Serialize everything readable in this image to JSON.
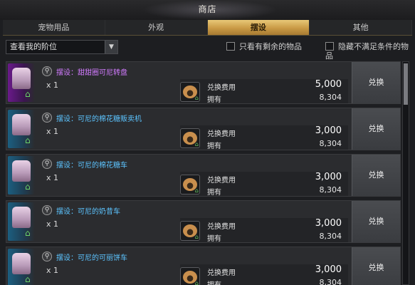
{
  "header": {
    "title": "商店"
  },
  "tabs": [
    {
      "label": "宠物用品",
      "active": false
    },
    {
      "label": "外观",
      "active": false
    },
    {
      "label": "摆设",
      "active": true
    },
    {
      "label": "其他",
      "active": false
    }
  ],
  "filters": {
    "dropdown_value": "查看我的阶位",
    "only_remaining": "只看有剩余的物品",
    "hide_unmet": "隐藏不满足条件的物品"
  },
  "labels": {
    "cost": "兑换费用",
    "owned": "拥有",
    "redeem_button": "兑换"
  },
  "items": [
    {
      "name": "摆设：甜甜圈可尼转盘",
      "quantity": "x 1",
      "cost": "5,000",
      "owned": "8,304",
      "rarity": "purple"
    },
    {
      "name": "摆设：可尼的棉花糖贩卖机",
      "quantity": "x 1",
      "cost": "3,000",
      "owned": "8,304",
      "rarity": "blue"
    },
    {
      "name": "摆设：可尼的棉花糖车",
      "quantity": "x 1",
      "cost": "3,000",
      "owned": "8,304",
      "rarity": "blue"
    },
    {
      "name": "摆设：可尼的奶昔车",
      "quantity": "x 1",
      "cost": "3,000",
      "owned": "8,304",
      "rarity": "blue"
    },
    {
      "name": "摆设：可尼的可丽饼车",
      "quantity": "x 1",
      "cost": "3,000",
      "owned": "8,304",
      "rarity": "blue"
    }
  ],
  "colors": {
    "active_tab": "#c99a45",
    "purple_name": "#d27bff",
    "blue_name": "#5cc4ff"
  },
  "icons": {
    "search": "magnifier-icon",
    "currency": "paw-token-icon",
    "house": "house-icon",
    "dropdown": "chevron-down-icon"
  }
}
